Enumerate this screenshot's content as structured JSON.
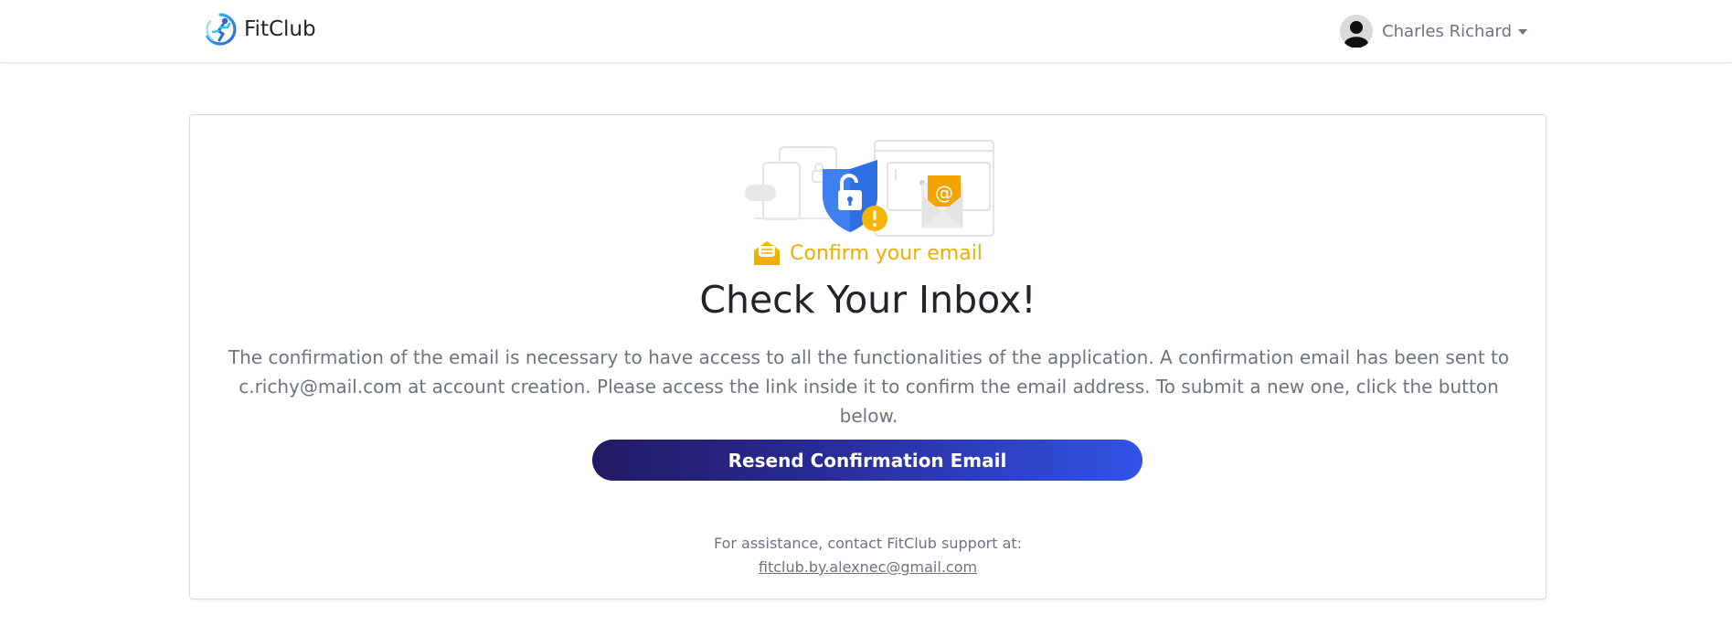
{
  "navbar": {
    "brand_name": "FitClub",
    "brand_logo_icon": "fitclub-runner-logo-icon",
    "user": {
      "name": "Charles Richard",
      "avatar_icon": "user-avatar-icon",
      "dropdown_icon": "caret-down-icon"
    }
  },
  "card": {
    "illustration_icon": "security-email-illustration",
    "eyebrow": {
      "icon": "envelope-open-icon",
      "text": "Confirm your email"
    },
    "title": "Check Your Inbox!",
    "description": "The confirmation of the email is necessary to have access to all the functionalities of the application. A confirmation email has been sent to c.richy@mail.com at account creation. Please access the link inside it to confirm the email address. To submit a new one, click the button below.",
    "resend_button_label": "Resend Confirmation Email",
    "support": {
      "text": "For assistance, contact FitClub support at:",
      "email": "fitclub.by.alexnec@gmail.com"
    }
  },
  "colors": {
    "accent_yellow": "#f0ad00",
    "button_gradient_start": "#211a63",
    "button_gradient_end": "#3153e6",
    "shield_blue": "#4285f4"
  }
}
